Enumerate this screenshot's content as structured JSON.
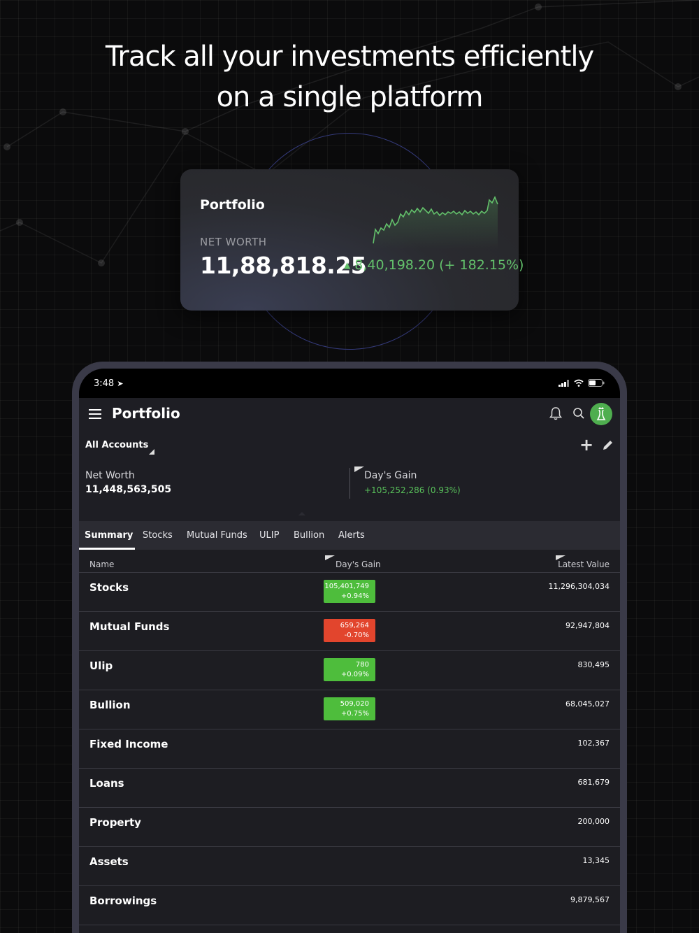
{
  "headline": {
    "line1": "Track all your investments efficiently",
    "line2": "on a single platform"
  },
  "promo_card": {
    "title": "Portfolio",
    "net_worth_label": "NET WORTH",
    "net_worth_value": "11,88,818.25",
    "gain_text": "8,40,198.20 (+ 182.15%)",
    "accent_color": "#63c16b"
  },
  "status_bar": {
    "time": "3:48",
    "icons": [
      "location-arrow-icon",
      "signal-icon",
      "wifi-icon",
      "battery-icon"
    ]
  },
  "app_bar": {
    "title": "Portfolio",
    "icons": [
      "hamburger-menu-icon",
      "bell-icon",
      "search-icon",
      "avatar"
    ]
  },
  "accounts": {
    "selector_label": "All Accounts"
  },
  "summary": {
    "net_worth_label": "Net Worth",
    "net_worth_value": "11,448,563,505",
    "days_gain_label": "Day's Gain",
    "days_gain_value": "+105,252,286 (0.93%)"
  },
  "tabs": [
    {
      "label": "Summary",
      "active": true
    },
    {
      "label": "Stocks",
      "active": false
    },
    {
      "label": "Mutual Funds",
      "active": false
    },
    {
      "label": "ULIP",
      "active": false
    },
    {
      "label": "Bullion",
      "active": false
    },
    {
      "label": "Alerts",
      "active": false
    }
  ],
  "table": {
    "columns": [
      "Name",
      "Day's Gain",
      "Latest Value"
    ],
    "rows": [
      {
        "name": "Stocks",
        "gain": "105,401,749",
        "gain_pct": "+0.94%",
        "direction": "up",
        "value": "11,296,304,034"
      },
      {
        "name": "Mutual Funds",
        "gain": "659,264",
        "gain_pct": "-0.70%",
        "direction": "down",
        "value": "92,947,804"
      },
      {
        "name": "Ulip",
        "gain": "780",
        "gain_pct": "+0.09%",
        "direction": "up",
        "value": "830,495"
      },
      {
        "name": "Bullion",
        "gain": "509,020",
        "gain_pct": "+0.75%",
        "direction": "up",
        "value": "68,045,027"
      },
      {
        "name": "Fixed Income",
        "gain": "",
        "gain_pct": "",
        "direction": "none",
        "value": "102,367"
      },
      {
        "name": "Loans",
        "gain": "",
        "gain_pct": "",
        "direction": "none",
        "value": "681,679"
      },
      {
        "name": "Property",
        "gain": "",
        "gain_pct": "",
        "direction": "none",
        "value": "200,000"
      },
      {
        "name": "Assets",
        "gain": "",
        "gain_pct": "",
        "direction": "none",
        "value": "13,345"
      },
      {
        "name": "Borrowings",
        "gain": "",
        "gain_pct": "",
        "direction": "none",
        "value": "9,879,567"
      }
    ]
  },
  "colors": {
    "gain_up": "#4ebd3c",
    "gain_down": "#e2452d",
    "background": "#0b0b0c",
    "app_background": "#1d1d22"
  }
}
